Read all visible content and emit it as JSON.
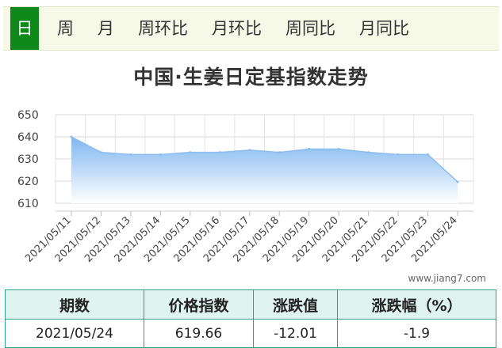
{
  "tabs": [
    "日",
    "周",
    "月",
    "周环比",
    "月环比",
    "周同比",
    "月同比"
  ],
  "active_tab": "日",
  "title": "中国·生姜日定基指数走势",
  "watermark": "www.jiang7.com",
  "colors": {
    "active_tab": "#0f8a1a",
    "area_top": "#7fb6f0",
    "area_bottom": "#ffffff",
    "line": "#8cbdf0",
    "table_border": "#2aa38b"
  },
  "chart_data": {
    "type": "area",
    "title": "中国·生姜日定基指数走势",
    "x": [
      "2021/05/11",
      "2021/05/12",
      "2021/05/13",
      "2021/05/14",
      "2021/05/15",
      "2021/05/16",
      "2021/05/17",
      "2021/05/18",
      "2021/05/19",
      "2021/05/20",
      "2021/05/21",
      "2021/05/22",
      "2021/05/23",
      "2021/05/24"
    ],
    "y": [
      640,
      633,
      632,
      632,
      633,
      633,
      634,
      633,
      634.5,
      634.5,
      633,
      632,
      632,
      619.66
    ],
    "ylim": [
      610,
      650
    ],
    "yticks": [
      610,
      620,
      630,
      640,
      650
    ],
    "grid": true
  },
  "table": {
    "headers": [
      "期数",
      "价格指数",
      "涨跌值",
      "涨跌幅（%）"
    ],
    "row": [
      "2021/05/24",
      "619.66",
      "-12.01",
      "-1.9"
    ]
  }
}
